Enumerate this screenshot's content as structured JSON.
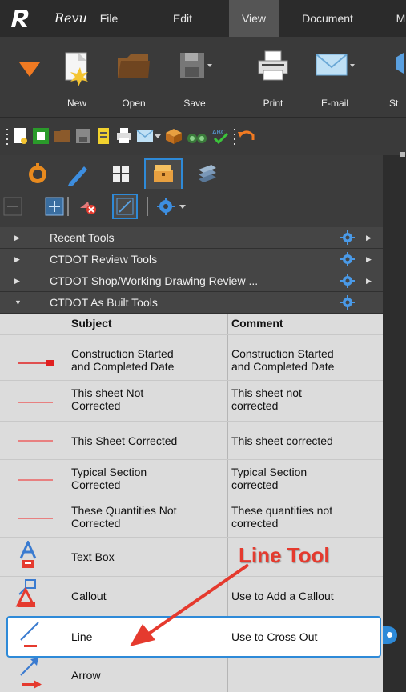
{
  "app": {
    "logo_text": "Revu"
  },
  "menu": [
    {
      "label": "File",
      "active": false
    },
    {
      "label": "Edit",
      "active": false
    },
    {
      "label": "View",
      "active": true
    },
    {
      "label": "Document",
      "active": false
    },
    {
      "label": "M",
      "active": false
    }
  ],
  "ribbon": {
    "buttons": [
      {
        "label": "New",
        "icon": "new-document-icon"
      },
      {
        "label": "Open",
        "icon": "open-folder-icon"
      },
      {
        "label": "Save",
        "icon": "save-icon"
      },
      {
        "label": "Print",
        "icon": "print-icon"
      },
      {
        "label": "E-mail",
        "icon": "email-icon"
      },
      {
        "label": "St",
        "icon": "stamp-icon"
      }
    ]
  },
  "sections": [
    {
      "title": "Recent Tools",
      "expanded": false
    },
    {
      "title": "CTDOT Review Tools",
      "expanded": false
    },
    {
      "title": "CTDOT Shop/Working Drawing Review ...",
      "expanded": false
    },
    {
      "title": "CTDOT As Built Tools",
      "expanded": true
    }
  ],
  "table": {
    "headers": {
      "subject": "Subject",
      "comment": "Comment"
    },
    "rows": [
      {
        "subject": [
          "Construction Started",
          "and Completed Date"
        ],
        "comment": [
          "Construction Started",
          "and Completed Date"
        ],
        "icon": "stamp-preview-icon"
      },
      {
        "subject": [
          "This sheet Not",
          "Corrected"
        ],
        "comment": [
          "This sheet not",
          "corrected"
        ],
        "icon": "stamp-preview-icon"
      },
      {
        "subject": [
          "This Sheet Corrected"
        ],
        "comment": [
          "This sheet corrected"
        ],
        "icon": "stamp-preview-icon"
      },
      {
        "subject": [
          "Typical Section",
          "Corrected"
        ],
        "comment": [
          "Typical Section",
          "corrected"
        ],
        "icon": "stamp-preview-icon"
      },
      {
        "subject": [
          "These Quantities Not",
          "Corrected"
        ],
        "comment": [
          "These quantities not",
          "corrected"
        ],
        "icon": "stamp-preview-icon"
      },
      {
        "subject": [
          "Text Box"
        ],
        "comment": [
          ""
        ],
        "icon": "text-box-icon"
      },
      {
        "subject": [
          "Callout"
        ],
        "comment": [
          "Use to Add a Callout"
        ],
        "icon": "callout-icon"
      },
      {
        "subject": [
          "Line"
        ],
        "comment": [
          "Use to Cross Out"
        ],
        "icon": "line-icon",
        "selected": true
      },
      {
        "subject": [
          "Arrow"
        ],
        "comment": [
          ""
        ],
        "icon": "arrow-icon"
      }
    ]
  },
  "annotation": {
    "text": "Line Tool",
    "color": "#e53a2e"
  },
  "colors": {
    "accent": "#2e8ad8",
    "annotation_red": "#e53a2e"
  }
}
